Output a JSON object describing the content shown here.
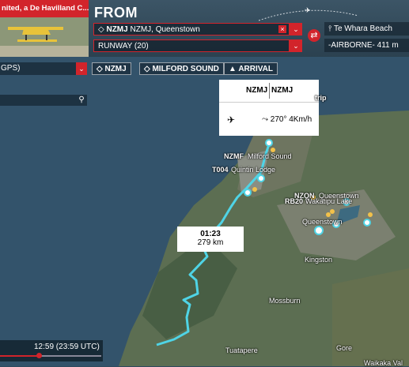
{
  "aircraft": {
    "title": "nited, a De Havilland C..."
  },
  "header": {
    "from_label": "FROM"
  },
  "origin": {
    "code": "NZMJ",
    "name": "NZMJ, Queenstown",
    "clear": "×",
    "dropdown": "⌄"
  },
  "runway": {
    "value": "RUNWAY (20)",
    "dropdown": "⌄"
  },
  "destination": {
    "name": "Te Whara Beach",
    "status": "-AIRBORNE- 411 m"
  },
  "nav_mode": {
    "value": "GPS)",
    "dropdown": "⌄"
  },
  "chips": {
    "origin": "NZMJ",
    "waypoint": "MILFORD SOUND",
    "arrival": "ARRIVAL"
  },
  "info_panel": {
    "code_left": "NZMJ",
    "code_right": "NZMJ",
    "wind": "270° 4Km/h"
  },
  "leg": {
    "time": "01:23",
    "distance": "279 km"
  },
  "map_labels": {
    "trip": "trip",
    "nzmf": "NZMF",
    "milford": "Milford Sound",
    "t004": "T004",
    "quintin": "Quintin Lodge",
    "nzqn": "NZQN",
    "queenstown_top": "Queenstown",
    "rb20": "RB20",
    "wakatipu": "Wakatipu Lake",
    "queenstown": "Queenstown",
    "kingston": "Kingston",
    "mossburn": "Mossburn",
    "tuatapere": "Tuatapere",
    "gore": "Gore",
    "waikaka": "Waikaka Val"
  },
  "timeline": {
    "time": "12:59 (23:59 UTC)",
    "progress": 0.38
  },
  "colors": {
    "accent": "#d2242b",
    "route": "#4fd4e6"
  }
}
